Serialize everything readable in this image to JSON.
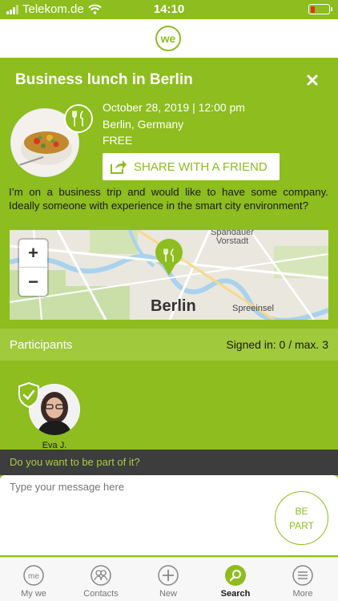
{
  "status_bar": {
    "carrier": "Telekom.de",
    "time": "14:10"
  },
  "header": {
    "logo_text": "we",
    "title": "Business lunch in Berlin"
  },
  "event": {
    "datetime": "October 28, 2019 | 12:00 pm",
    "location": "Berlin, Germany",
    "price": "FREE",
    "share_label": "SHARE WITH A FRIEND",
    "description": "I’m on a business trip and would like to have some company. Ideally someone with experience in the smart city environment?"
  },
  "map": {
    "zoom_in_label": "+",
    "zoom_out_label": "−",
    "city_label": "Berlin",
    "district_label": "Spreeinsel",
    "district_label_2": "Spandauer Vorstadt"
  },
  "participants": {
    "title": "Participants",
    "signed_in": "Signed in: 0 / max. 3",
    "people": [
      {
        "name": "Eva J."
      }
    ]
  },
  "join": {
    "prompt": "Do you want to be part of it?",
    "message_placeholder": "Type your message here",
    "be_part_line1": "BE",
    "be_part_line2": "PART"
  },
  "tabs": [
    {
      "label": "My we",
      "icon": "my-we-icon"
    },
    {
      "label": "Contacts",
      "icon": "contacts-icon"
    },
    {
      "label": "New",
      "icon": "plus-icon"
    },
    {
      "label": "Search",
      "icon": "search-icon",
      "active": true
    },
    {
      "label": "More",
      "icon": "menu-icon"
    }
  ],
  "colors": {
    "brand": "#8dbd1e",
    "bar_light": "#a0c93b",
    "dark_bar": "#3d3d3d",
    "battery_low": "#e8301c"
  }
}
